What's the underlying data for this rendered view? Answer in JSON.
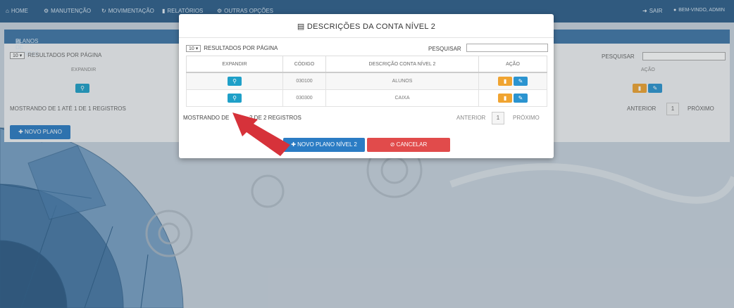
{
  "navbar": {
    "items": [
      {
        "icon": "home-icon",
        "glyph": "⌂",
        "label": "HOME"
      },
      {
        "icon": "gear-icon",
        "glyph": "⚙",
        "label": "MANUTENÇÃO"
      },
      {
        "icon": "refresh-icon",
        "glyph": "↻",
        "label": "MOVIMENTAÇÃO"
      },
      {
        "icon": "chart-icon",
        "glyph": "▮",
        "label": "RELATÓRIOS"
      },
      {
        "icon": "gears-icon",
        "glyph": "⚙",
        "label": "OUTRAS OPÇÕES"
      }
    ],
    "logout_label": "SAIR",
    "user_label": "BEM-VINDO, ADMIN"
  },
  "background_panel": {
    "title": "PLANOS DE CONTAS",
    "page_size": "10",
    "results_label": "RESULTADOS POR PÁGINA",
    "search_label": "PESQUISAR",
    "col_expand": "EXPANDIR",
    "col_action": "AÇÃO",
    "info": "MOSTRANDO DE 1 ATÉ 1 DE 1 REGISTROS",
    "prev": "ANTERIOR",
    "page": "1",
    "next": "PRÓXIMO",
    "new_button": "NOVO PLANO"
  },
  "modal": {
    "title": "DESCRIÇÕES DA CONTA NÍVEL 2",
    "page_size": "10",
    "results_label": "RESULTADOS POR PÁGINA",
    "search_label": "PESQUISAR",
    "search_value": "",
    "columns": [
      "EXPANDIR",
      "CÓDIGO",
      "DESCRIÇÃO CONTA NÍVEL 2",
      "AÇÃO"
    ],
    "rows": [
      {
        "code": "030100",
        "description": "ALUNOS"
      },
      {
        "code": "030300",
        "description": "CAIXA"
      }
    ],
    "info_visible_start": "MOSTRANDO DE",
    "info_visible_end": "2 DE 2 REGISTROS",
    "prev": "ANTERIOR",
    "page": "1",
    "next": "PRÓXIMO",
    "new_button": "NOVO PLANO NÍVEL 2",
    "cancel_button": "CANCELAR"
  },
  "colors": {
    "navbar": "#2e5f8a",
    "primary": "#2b7cc4",
    "danger": "#e14b4b",
    "info": "#1fa0c8",
    "warning": "#f0a431",
    "arrow": "#d6323a"
  }
}
